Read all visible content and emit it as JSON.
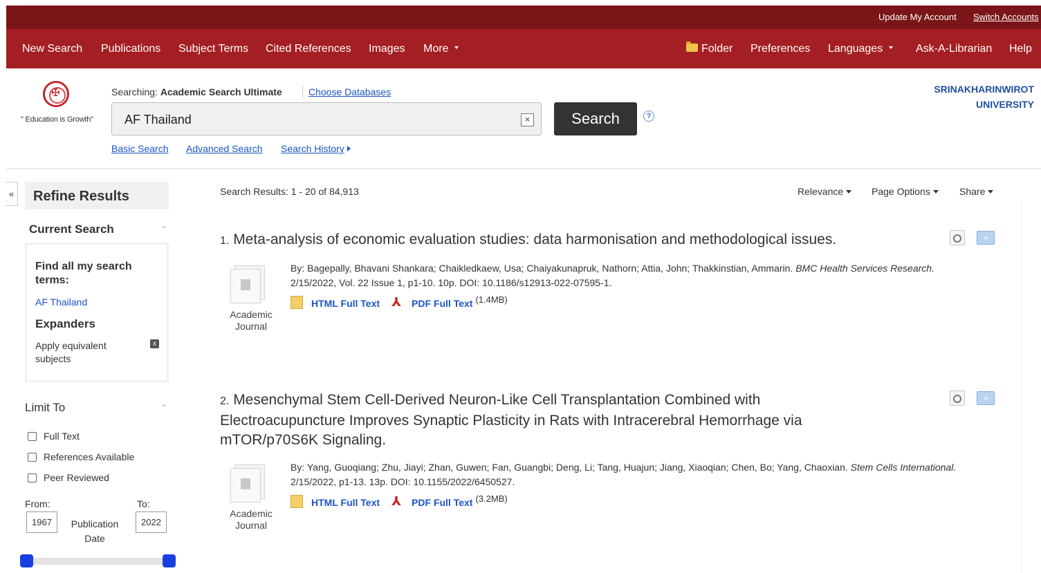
{
  "topbar": {
    "update_account": "Update My Account",
    "switch_accounts": "Switch Accounts"
  },
  "nav": {
    "new_search": "New Search",
    "publications": "Publications",
    "subject_terms": "Subject Terms",
    "cited_references": "Cited References",
    "images": "Images",
    "more": "More",
    "folder": "Folder",
    "preferences": "Preferences",
    "languages": "Languages",
    "ask_librarian": "Ask-A-Librarian",
    "help": "Help"
  },
  "header": {
    "tagline": "\" Education is Growth\"",
    "searching_label": "Searching:",
    "database": "Academic Search Ultimate",
    "choose_databases": "Choose Databases",
    "search_value": "AF Thailand",
    "search_button": "Search",
    "help_glyph": "?",
    "clear_glyph": "×",
    "basic_search": "Basic Search",
    "advanced_search": "Advanced Search",
    "search_history": "Search History",
    "university_line1": "SRINAKHARINWIROT",
    "university_line2": "UNIVERSITY"
  },
  "sidebar": {
    "collapse_glyph": "«",
    "refine_results": "Refine Results",
    "current_search": "Current Search",
    "find_all": "Find all my search terms:",
    "search_term": "AF Thailand",
    "expanders": "Expanders",
    "apply_equivalent": "Apply equivalent subjects",
    "remove_glyph": "x",
    "limit_to": "Limit To",
    "limits": [
      "Full Text",
      "References Available",
      "Peer Reviewed"
    ],
    "from_label": "From:",
    "to_label": "To:",
    "from_year": "1967",
    "to_year": "2022",
    "publication_date": "Publication Date",
    "chevron_glyph": "⌄"
  },
  "results": {
    "count_text": "Search Results: 1 - 20 of 84,913",
    "relevance": "Relevance",
    "page_options": "Page Options",
    "share": "Share",
    "items": [
      {
        "number": "1.",
        "title": "Meta-analysis of economic evaluation studies: data harmonisation and methodological issues.",
        "type_line1": "Academic",
        "type_line2": "Journal",
        "authors": "By: Bagepally, Bhavani Shankara; Chaikledkaew, Usa; Chaiyakunapruk, Nathorn; Attia, John; Thakkinstian, Ammarin.",
        "journal": "BMC Health Services Research.",
        "details": "2/15/2022, Vol. 22 Issue 1, p1-10. 10p. DOI: 10.1186/s12913-022-07595-1.",
        "html_full_text": "HTML Full Text",
        "pdf_full_text": "PDF Full Text",
        "pdf_size": "(1.4MB)"
      },
      {
        "number": "2.",
        "title": "Mesenchymal Stem Cell-Derived Neuron-Like Cell Transplantation Combined with Electroacupuncture Improves Synaptic Plasticity in Rats with Intracerebral Hemorrhage via mTOR/p70S6K Signaling.",
        "type_line1": "Academic",
        "type_line2": "Journal",
        "authors": "By: Yang, Guoqiang; Zhu, Jiayi; Zhan, Guwen; Fan, Guangbi; Deng, Li; Tang, Huajun; Jiang, Xiaoqian; Chen, Bo; Yang, Chaoxian.",
        "journal": "Stem Cells International.",
        "details": "2/15/2022, p1-13. 13p. DOI: 10.1155/2022/6450527.",
        "html_full_text": "HTML Full Text",
        "pdf_full_text": "PDF Full Text",
        "pdf_size": "(3.2MB)"
      }
    ],
    "add_folder_glyph": "+",
    "pdf_glyph": "⅄"
  },
  "colors": {
    "topbar": "#7a1518",
    "navbar": "#a41f23",
    "link": "#1a55c4",
    "university": "#1f4f9f",
    "slider_handle": "#1a3fe0"
  }
}
